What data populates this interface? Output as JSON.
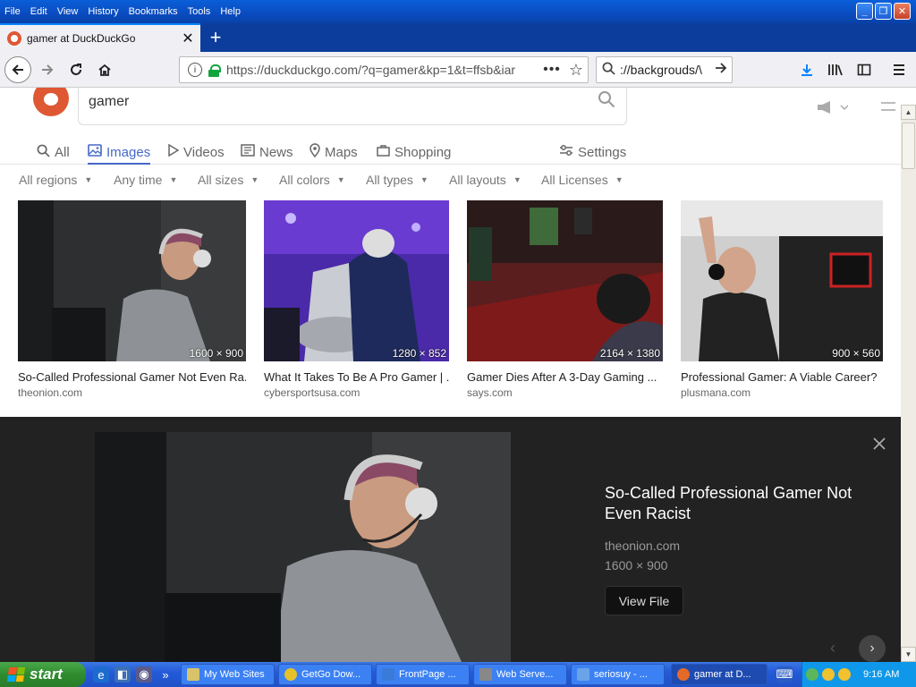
{
  "menu": [
    "File",
    "Edit",
    "View",
    "History",
    "Bookmarks",
    "Tools",
    "Help"
  ],
  "tab": {
    "title": "gamer at DuckDuckGo",
    "close": "✕"
  },
  "newtab": "+",
  "nav": {
    "url": "https://duckduckgo.com/?q=gamer&kp=1&t=ffsb&iar",
    "search_text": "://backgrouds/\\",
    "more": "•••"
  },
  "page": {
    "query": "gamer",
    "verticals": [
      {
        "label": "All",
        "icon": "search-icon"
      },
      {
        "label": "Images",
        "icon": "image-icon"
      },
      {
        "label": "Videos",
        "icon": "play-icon"
      },
      {
        "label": "News",
        "icon": "news-icon"
      },
      {
        "label": "Maps",
        "icon": "pin-icon"
      },
      {
        "label": "Shopping",
        "icon": "bag-icon"
      },
      {
        "label": "Settings",
        "icon": "sliders-icon"
      }
    ],
    "filters": [
      "All regions",
      "Any time",
      "All sizes",
      "All colors",
      "All types",
      "All layouts",
      "All Licenses"
    ],
    "results": [
      {
        "title": "So-Called Professional Gamer Not Even Ra...",
        "domain": "theonion.com",
        "dims": "1600 × 900"
      },
      {
        "title": "What It Takes To Be A Pro Gamer | ...",
        "domain": "cybersportsusa.com",
        "dims": "1280 × 852"
      },
      {
        "title": "Gamer Dies After A 3-Day Gaming ...",
        "domain": "says.com",
        "dims": "2164 × 1380"
      },
      {
        "title": "Professional Gamer: A Viable Career?",
        "domain": "plusmana.com",
        "dims": "900 × 560"
      }
    ],
    "detail": {
      "title": "So-Called Professional Gamer Not Even Racist",
      "domain": "theonion.com",
      "dims": "1600 × 900",
      "view_label": "View File"
    }
  },
  "taskbar": {
    "start": "start",
    "items": [
      "My Web Sites",
      "GetGo Dow...",
      "FrontPage ...",
      "Web Serve...",
      "seriosuy - ...",
      "gamer at D..."
    ],
    "clock": "9:16 AM"
  },
  "colors": {
    "accent": "#4468c7",
    "ddg_orange": "#de5833",
    "detail_bg": "#222222"
  }
}
